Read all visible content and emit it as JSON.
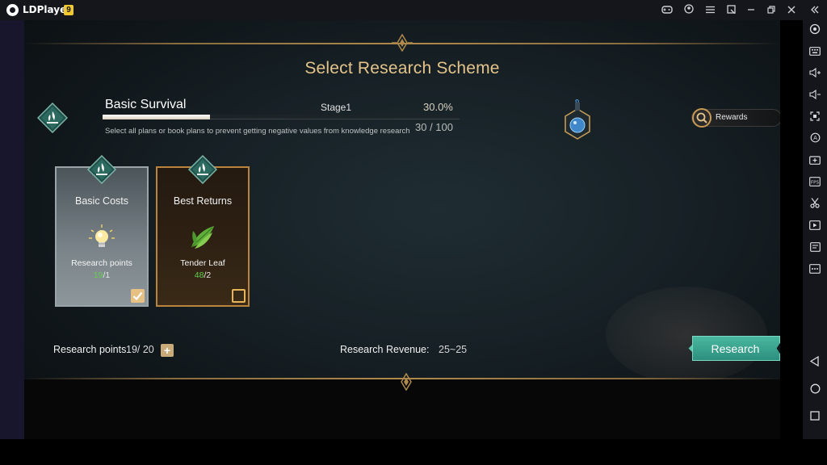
{
  "window": {
    "app_name": "LDPlayer",
    "version_badge": "9",
    "titlebar_icons": [
      "gamepad-icon",
      "account-icon",
      "menu-icon",
      "window-sync-icon",
      "minimize-icon",
      "restore-icon",
      "close-icon",
      "collapse-sidebar-icon"
    ]
  },
  "sidebar": {
    "icons": [
      "settings-icon",
      "keyboard-icon",
      "volume-up-icon",
      "volume-down-icon",
      "screenshot-icon",
      "rotate-icon",
      "install-apk-icon",
      "fps-icon",
      "cut-icon",
      "record-icon",
      "operations-icon",
      "more-icon",
      "back-icon",
      "home-icon",
      "recent-apps-icon"
    ]
  },
  "game": {
    "screen_title": "Select Research Scheme",
    "scheme": {
      "name": "Basic Survival",
      "stage_label": "Stage1",
      "percent_text": "30.0%",
      "progress": 0.3,
      "description": "Select all plans or book plans to prevent getting negative values from knowledge research",
      "count_text": "30 / 100"
    },
    "rewards_label": "Rewards",
    "plans": [
      {
        "title": "Basic Costs",
        "item_name": "Research points",
        "have": "19",
        "sep_need": "/1",
        "checked": true,
        "icon": "lightbulb-icon"
      },
      {
        "title": "Best Returns",
        "item_name": "Tender Leaf",
        "have": "48",
        "sep_need": "/2",
        "checked": false,
        "icon": "leaf-icon"
      }
    ],
    "research_points_label": "Research points",
    "research_points_value": "19/ 20",
    "research_points_plus": "+",
    "revenue_label": "Research Revenue:",
    "revenue_value": "25~25",
    "research_button": "Research"
  },
  "colors": {
    "title_gold": "#e4c48a",
    "research_teal": "#3aa58f",
    "count_green": "#62d14c"
  }
}
